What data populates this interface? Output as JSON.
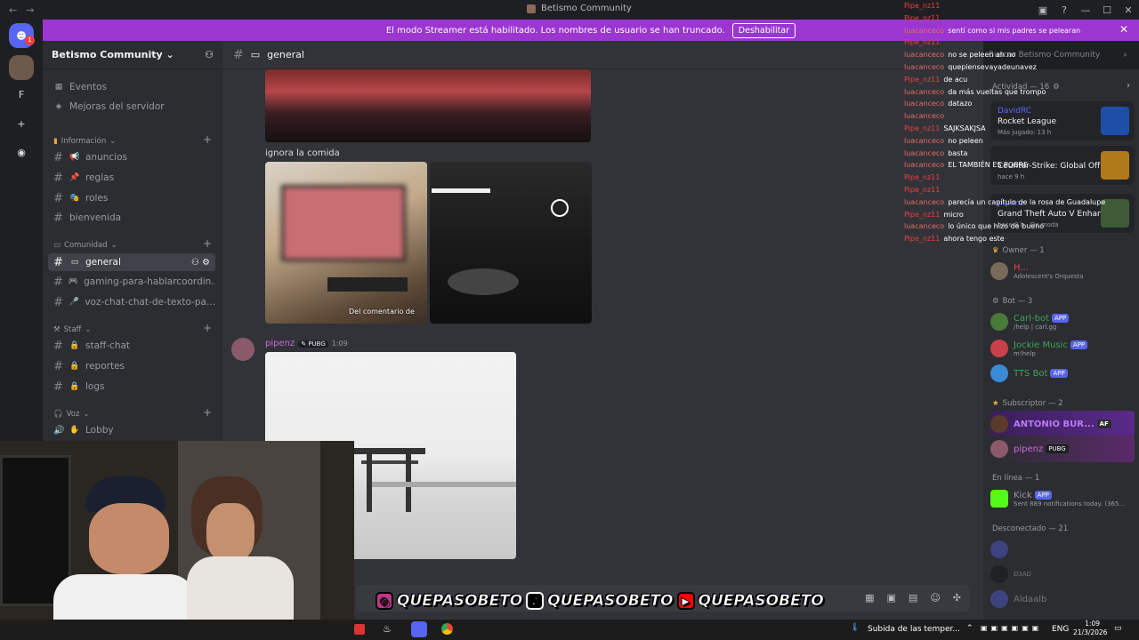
{
  "window": {
    "title": "Betismo Community"
  },
  "banner": {
    "text": "El modo Streamer está habilitado. Los nombres de usuario se han truncado.",
    "button": "Deshabilitar"
  },
  "server_rail": {
    "badge": "1",
    "letter": "F"
  },
  "server": {
    "name": "Betismo Community"
  },
  "sidebar": {
    "top_items": [
      "Eventos",
      "Mejoras del servidor"
    ],
    "categories": {
      "info": "Información",
      "community": "Comunidad",
      "staff": "Staff",
      "voice": "Voz"
    },
    "info_channels": [
      "anuncios",
      "reglas",
      "roles",
      "bienvenida"
    ],
    "community_channels": [
      "general",
      "gaming-para-hablarcoordin...",
      "voz-chat-chat-de-texto-pa..."
    ],
    "staff_channels": [
      "staff-chat",
      "reportes",
      "logs"
    ],
    "voice_channels": [
      "Lobby"
    ]
  },
  "chat": {
    "channel": "general",
    "caption": "ignora la comida",
    "image_caption": "Del comentario de",
    "author": "pipenz",
    "author_tag": "PUBG",
    "time": "1:09"
  },
  "search": {
    "placeholder": "Buscar Betismo Community"
  },
  "twitch_chat": [
    {
      "user": "Pipe_nz11",
      "text": ""
    },
    {
      "user": "Pipe_nz11",
      "text": ""
    },
    {
      "user": "luacanceco",
      "text": "sentí como si mis padres se pelearan"
    },
    {
      "user": "Pipe_nz11",
      "text": ""
    },
    {
      "user": "luacanceco",
      "text": "no se peleen ah no"
    },
    {
      "user": "luacanceco",
      "text": "quepiensevayadeunavez"
    },
    {
      "user": "Pipe_nz11",
      "text": "de acu"
    },
    {
      "user": "luacanceco",
      "text": "da más vueltas que trompo"
    },
    {
      "user": "luacanceco",
      "text": "datazo"
    },
    {
      "user": "luacanceco",
      "text": ""
    },
    {
      "user": "Pipe_nz11",
      "text": "SAJKSAKJSA"
    },
    {
      "user": "luacanceco",
      "text": "no peleen"
    },
    {
      "user": "luacanceco",
      "text": "basta"
    },
    {
      "user": "luacanceco",
      "text": "EL TAMBIÉN ES POBRE"
    },
    {
      "user": "Pipe_nz11",
      "text": ""
    },
    {
      "user": "Pipe_nz11",
      "text": ""
    },
    {
      "user": "luacanceco",
      "text": "parecía un capítulo de la rosa de Guadalupe"
    },
    {
      "user": "Pipe_nz11",
      "text": "micro"
    },
    {
      "user": "luacanceco",
      "text": "lo único que hizo de bueno"
    },
    {
      "user": "Pipe_nz11",
      "text": "ahora tengo este"
    }
  ],
  "members": {
    "activity_header": "Actividad — 16",
    "activities": [
      {
        "user": "DavidRC",
        "game": "Rocket League",
        "meta": "Más jugado: 13 h",
        "color": "#1d4fa8"
      },
      {
        "user": "",
        "game": "Counter-Strike: Global Off...",
        "meta": "hace 9 h",
        "color": "#b07a1a"
      },
      {
        "user": "pipenz",
        "game": "Grand Theft Auto V Enhan...",
        "meta": "hace 8 h · De moda",
        "color": "#3f5a36"
      }
    ],
    "owner_header": "Owner — 1",
    "owner": {
      "name": "H...",
      "status": "Adolescent's Orquesta"
    },
    "bot_header": "Bot — 3",
    "bots": [
      {
        "name": "Carl-bot",
        "status": "/help | carl.gg",
        "color": "#3ba55c"
      },
      {
        "name": "Jockie Music",
        "status": "m!help",
        "color": "#3ba55c"
      },
      {
        "name": "TTS Bot",
        "status": "",
        "color": "#3ba55c"
      }
    ],
    "sub_header": "Subscriptor — 2",
    "subs": [
      {
        "name": "ANTONIO BUR...",
        "tag": "AF"
      },
      {
        "name": "pipenz",
        "tag": "PUBG"
      }
    ],
    "online_header": "En línea — 1",
    "online": {
      "name": "Kick",
      "status": "Sent 889 notifications today. (365..."
    },
    "offline_header": "Desconectado — 21",
    "offline": [
      "",
      "D3AD",
      "Aldaalb"
    ],
    "app_tag": "APP"
  },
  "socials": [
    "QUEPASOBETO",
    "QUEPASOBETO",
    "QUEPASOBETO"
  ],
  "taskbar": {
    "weather": "Subida de las temper...",
    "lang": "ENG",
    "time": "1:09",
    "date": "21/3/2026"
  }
}
